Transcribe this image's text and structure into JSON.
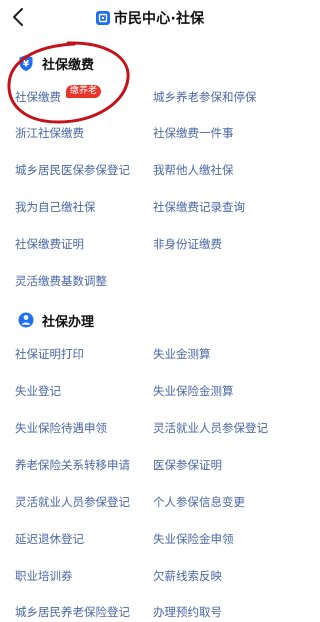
{
  "header": {
    "title": "市民中心·社保",
    "back_icon": "chevron-left-icon",
    "logo_icon": "app-logo-icon"
  },
  "colors": {
    "accent": "#1e6ff5",
    "link": "#4a67a6",
    "badge": "#e8352b",
    "annotation": "#c4121a"
  },
  "sections": [
    {
      "title": "社保缴费",
      "icon": "shield-yen-icon",
      "items": [
        [
          "社保缴费",
          "城乡养老参保和停保"
        ],
        [
          "浙江社保缴费",
          "社保缴费一件事"
        ],
        [
          "城乡居民医保参保登记",
          "我帮他人缴社保"
        ],
        [
          "我为自己缴社保",
          "社保缴费记录查询"
        ],
        [
          "社保缴费证明",
          "非身份证缴费"
        ],
        [
          "灵活缴费基数调整",
          ""
        ]
      ],
      "badge": "缴养老"
    },
    {
      "title": "社保办理",
      "icon": "person-icon",
      "items": [
        [
          "社保证明打印",
          "失业金测算"
        ],
        [
          "失业登记",
          "失业保险金测算"
        ],
        [
          "失业保险待遇申领",
          "灵活就业人员参保登记"
        ],
        [
          "养老保险关系转移申请",
          "医保参保证明"
        ],
        [
          "灵活就业人员参保登记",
          "个人参保信息变更"
        ],
        [
          "延迟退休登记",
          "失业保险金申领"
        ],
        [
          "职业培训券",
          "欠薪线索反映"
        ],
        [
          "城乡居民养老保险登记",
          "办理预约取号"
        ]
      ]
    }
  ]
}
